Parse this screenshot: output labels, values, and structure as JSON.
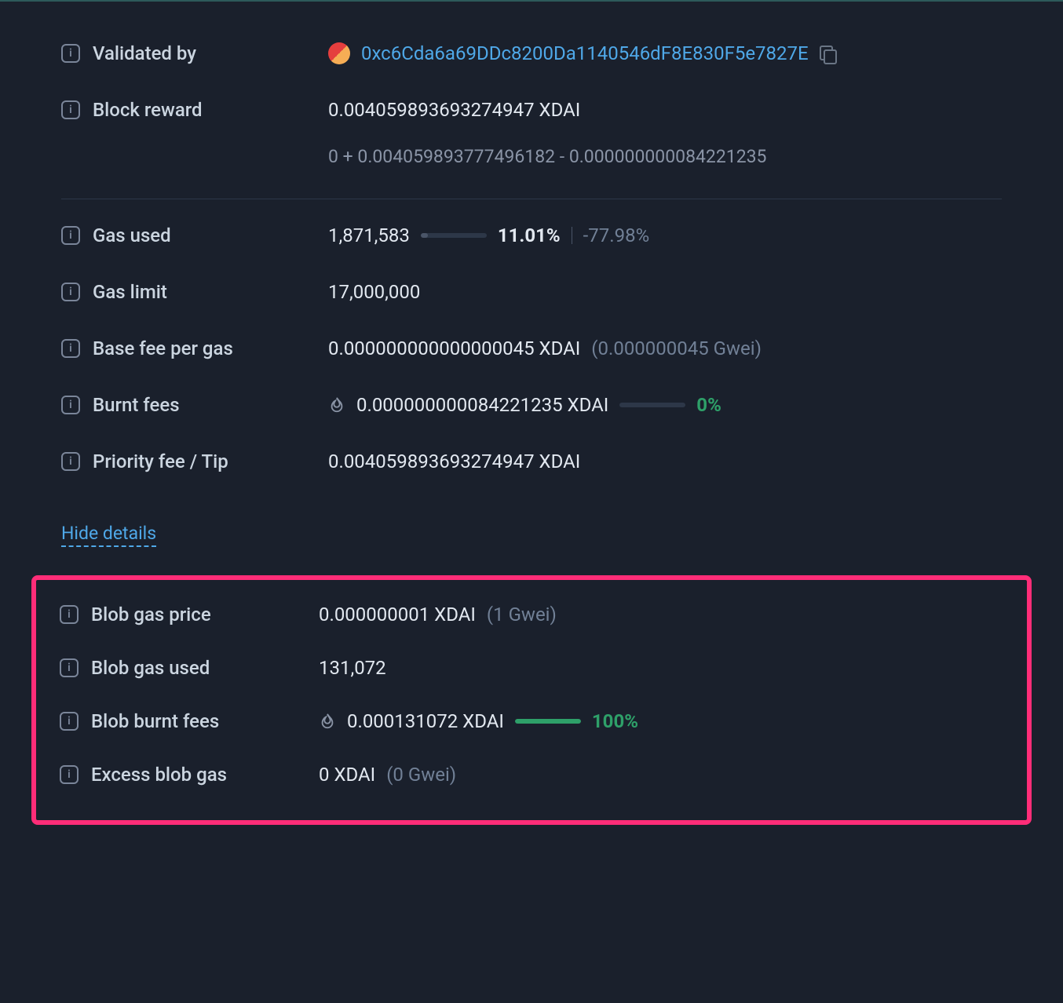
{
  "validated_by": {
    "label": "Validated by",
    "address": "0xc6Cda6a69DDc8200Da1140546dF8E830F5e7827E"
  },
  "block_reward": {
    "label": "Block reward",
    "value": "0.004059893693274947 XDAI",
    "breakdown": "0 + 0.004059893777496182 - 0.000000000084221235"
  },
  "gas_used": {
    "label": "Gas used",
    "value": "1,871,583",
    "percent": "11.01%",
    "progress_pct": 11,
    "delta": "-77.98%"
  },
  "gas_limit": {
    "label": "Gas limit",
    "value": "17,000,000"
  },
  "base_fee": {
    "label": "Base fee per gas",
    "value": "0.000000000000000045 XDAI",
    "gwei": "(0.000000045 Gwei)"
  },
  "burnt_fees": {
    "label": "Burnt fees",
    "value": "0.000000000084221235 XDAI",
    "percent": "0%",
    "progress_pct": 0
  },
  "priority_fee": {
    "label": "Priority fee / Tip",
    "value": "0.004059893693274947 XDAI"
  },
  "hide_details": "Hide details",
  "blob_gas_price": {
    "label": "Blob gas price",
    "value": "0.000000001 XDAI",
    "gwei": "(1 Gwei)"
  },
  "blob_gas_used": {
    "label": "Blob gas used",
    "value": "131,072"
  },
  "blob_burnt_fees": {
    "label": "Blob burnt fees",
    "value": "0.000131072 XDAI",
    "percent": "100%",
    "progress_pct": 100
  },
  "excess_blob_gas": {
    "label": "Excess blob gas",
    "value": "0 XDAI",
    "gwei": "(0 Gwei)"
  }
}
